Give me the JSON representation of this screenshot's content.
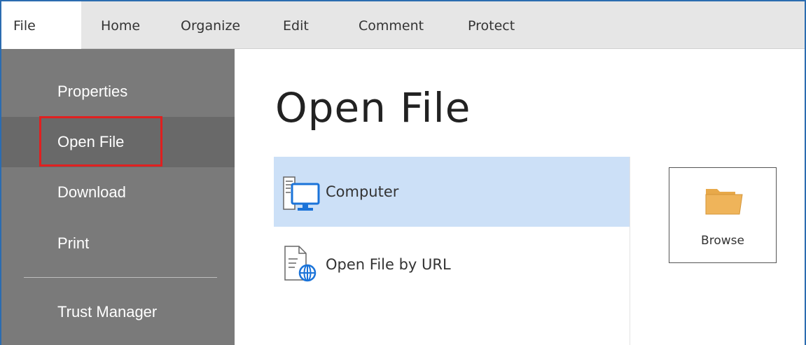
{
  "ribbon": {
    "tabs": [
      {
        "label": "File",
        "active": true
      },
      {
        "label": "Home"
      },
      {
        "label": "Organize"
      },
      {
        "label": "Edit"
      },
      {
        "label": "Comment"
      },
      {
        "label": "Protect"
      }
    ]
  },
  "sidebar": {
    "items": [
      {
        "label": "Properties"
      },
      {
        "label": "Open File",
        "selected": true
      },
      {
        "label": "Download"
      },
      {
        "label": "Print"
      },
      {
        "label": "Trust Manager"
      }
    ]
  },
  "main": {
    "title": "Open File",
    "locations": [
      {
        "label": "Computer",
        "icon": "computer-icon",
        "selected": true
      },
      {
        "label": "Open File by URL",
        "icon": "url-document-icon"
      }
    ],
    "browse": {
      "label": "Browse",
      "icon": "folder-icon"
    }
  },
  "colors": {
    "accent_border": "#2b6cb0",
    "sidebar_bg": "#7a7a7a",
    "sidebar_selected": "#696969",
    "highlight": "#e02020",
    "location_selected": "#cce0f7",
    "folder": "#e8a94a"
  }
}
